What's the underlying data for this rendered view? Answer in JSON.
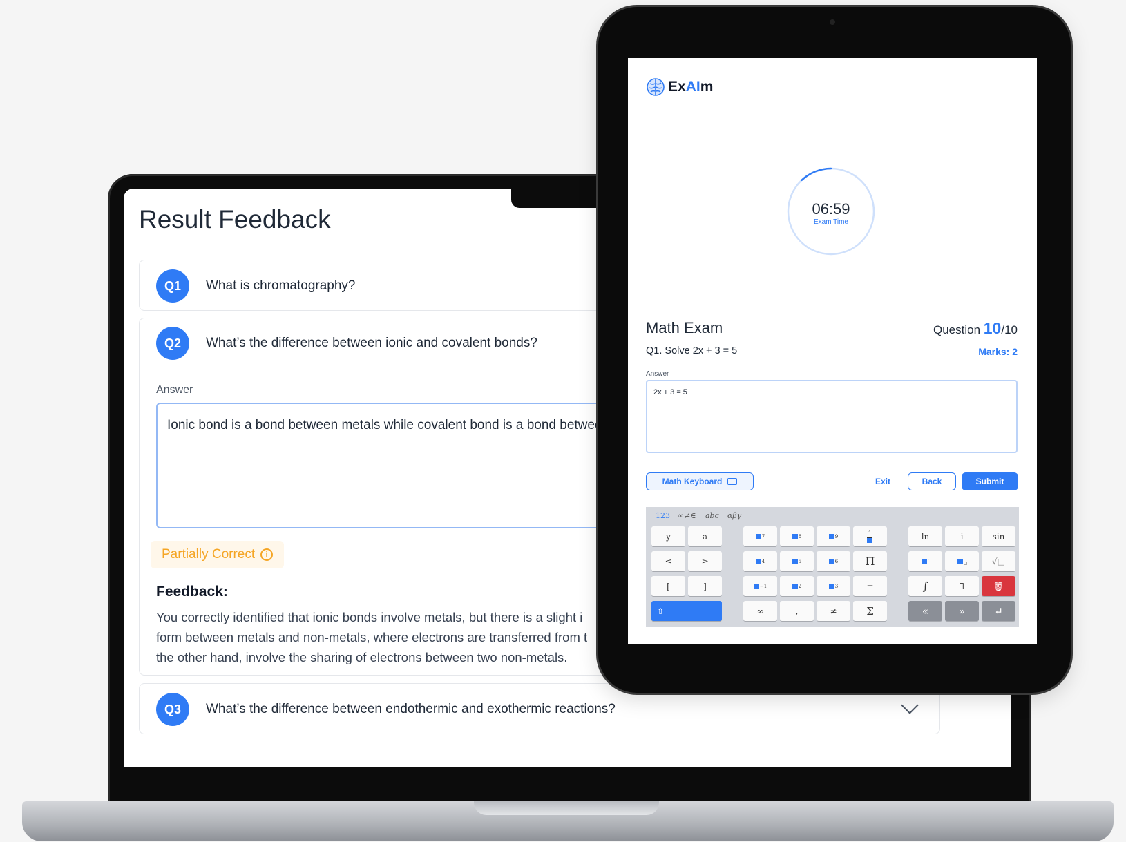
{
  "result_feedback": {
    "title": "Result Feedback",
    "questions": [
      {
        "badge": "Q1",
        "text": "What is chromatography?"
      },
      {
        "badge": "Q2",
        "text": "What’s the difference between ionic and covalent bonds?"
      },
      {
        "badge": "Q3",
        "text": "What’s the difference between endothermic and exothermic reactions?"
      }
    ],
    "answer_label": "Answer",
    "answer_text": "Ionic bond is a bond between metals while covalent bond is a bond betwee",
    "status": "Partially Correct",
    "status_color": "#f5a524",
    "feedback_label": "Feedback:",
    "feedback_lines": [
      "You correctly identified that ionic bonds involve metals, but there is a slight i",
      "form between metals and non-metals, where electrons are transferred from t",
      "the other hand, involve the sharing of electrons between two non-metals."
    ]
  },
  "exam": {
    "logo_prefix": "Ex",
    "logo_ai": "AI",
    "logo_suffix": "m",
    "timer_value": "06:59",
    "timer_label": "Exam Time",
    "timer_progress": 0.12,
    "exam_title": "Math Exam",
    "question_prefix": "Question ",
    "question_current": "10",
    "question_total": "/10",
    "question_prompt": "Q1. Solve 2x + 3 = 5",
    "marks": "Marks: 2",
    "answer_label": "Answer",
    "answer_value": "2x + 3 = 5",
    "math_keyboard_label": "Math Keyboard",
    "exit_label": "Exit",
    "back_label": "Back",
    "submit_label": "Submit",
    "accent_color": "#2f7bf5"
  },
  "keyboard": {
    "tabs": [
      "123",
      "∞≠∈",
      "abc",
      "αβγ"
    ],
    "keys": {
      "y": "y",
      "a": "a",
      "le": "≤",
      "ge": "≥",
      "lbr": "[",
      "rbr": "]",
      "pi": "Π",
      "pm": "±",
      "inf": "∞",
      "comma": ",",
      "ne": "≠",
      "sum": "Σ",
      "ln": "ln",
      "i": "i",
      "sin": "sin",
      "sqrt": "√□",
      "int": "∫",
      "exists": "∃",
      "prev": "«",
      "next": "»",
      "enter": "↵",
      "shift": "⇧",
      "del": "🗑",
      "p7": "7",
      "p8": "8",
      "p9": "9",
      "p4": "4",
      "p5": "5",
      "p6": "6",
      "pm1": "−1",
      "p2": "2",
      "p3": "3",
      "prime": "′",
      "frac_num": "1"
    }
  }
}
